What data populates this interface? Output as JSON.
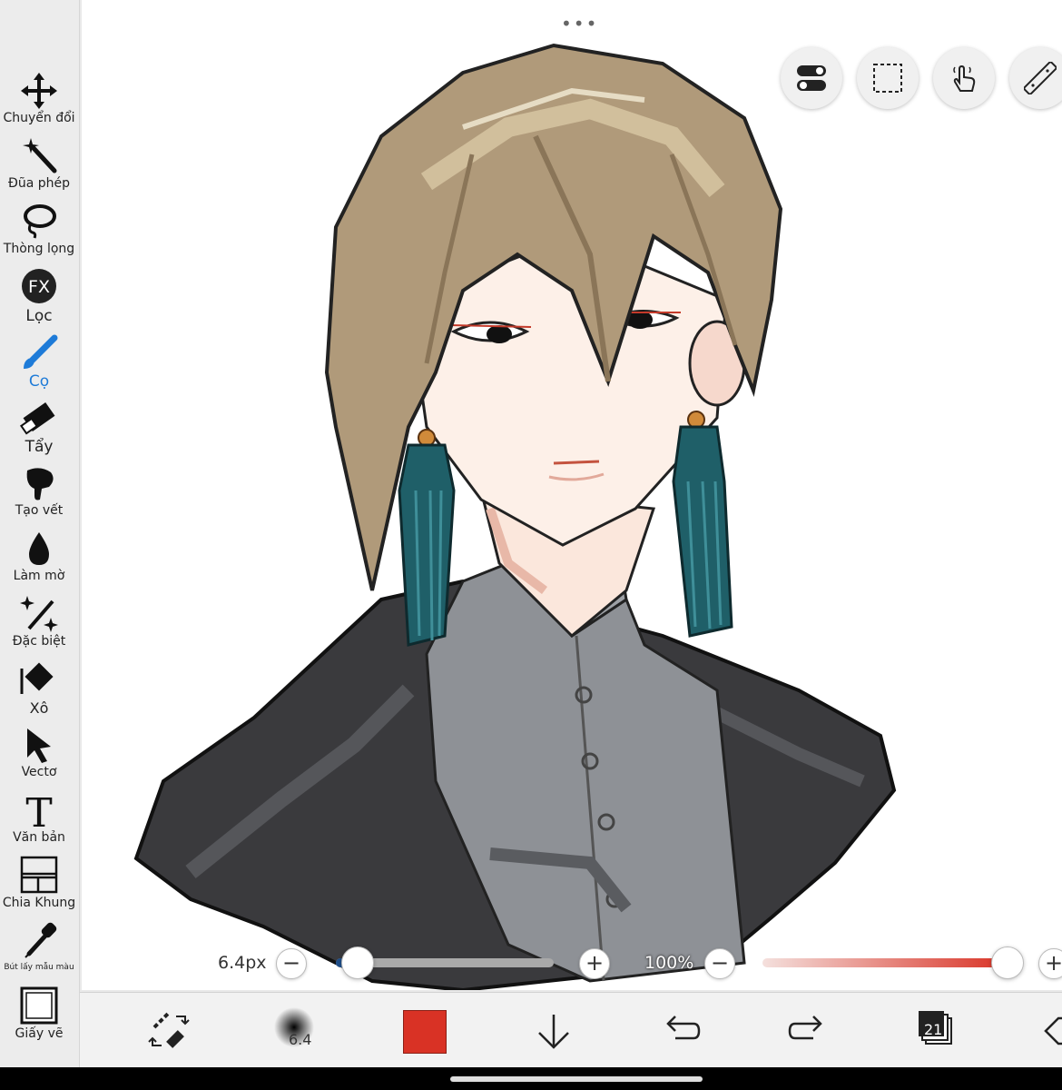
{
  "sidebar": {
    "tools": [
      {
        "label": "Chuyển đổi",
        "icon": "move-arrows-icon",
        "active": false
      },
      {
        "label": "Đũa phép",
        "icon": "magic-wand-icon",
        "active": false
      },
      {
        "label": "Thòng lọng",
        "icon": "lasso-icon",
        "active": false
      },
      {
        "label": "Lọc",
        "icon": "fx-filter-icon",
        "active": false,
        "icon_text": "FX"
      },
      {
        "label": "Cọ",
        "icon": "brush-icon",
        "active": true
      },
      {
        "label": "Tẩy",
        "icon": "eraser-icon",
        "active": false
      },
      {
        "label": "Tạo vết",
        "icon": "smudge-icon",
        "active": false
      },
      {
        "label": "Làm mờ",
        "icon": "blur-drop-icon",
        "active": false
      },
      {
        "label": "Đặc biệt",
        "icon": "special-sparkle-icon",
        "active": false
      },
      {
        "label": "Xô",
        "icon": "bucket-icon",
        "active": false
      },
      {
        "label": "Vectơ",
        "icon": "vector-cursor-icon",
        "active": false
      },
      {
        "label": "Văn bản",
        "icon": "text-icon",
        "active": false,
        "icon_text": "T"
      },
      {
        "label": "Chia Khung",
        "icon": "frame-divider-icon",
        "active": false
      },
      {
        "label": "Bút lấy mẫu màu",
        "icon": "eyedropper-icon",
        "active": false
      },
      {
        "label": "Giấy vẽ",
        "icon": "canvas-paper-icon",
        "active": false
      }
    ]
  },
  "top_controls": {
    "more_dots": "•••",
    "buttons": [
      "toggle-settings-icon",
      "selection-icon",
      "touch-gesture-icon",
      "ruler-icon"
    ]
  },
  "slider_row": {
    "brush_size": "6.4px",
    "brush_size_fraction": 0.03,
    "minus": "−",
    "plus": "+",
    "opacity": "100%",
    "opacity_fraction": 1.0
  },
  "bottom_bar": {
    "brush_preview_size": "6.4",
    "color": "#d93225",
    "layers_count": "21",
    "icons": [
      "swap-brush-eraser-icon",
      "brush-preview-icon",
      "color-swatch",
      "download-arrow-icon",
      "undo-icon",
      "redo-icon",
      "layers-icon",
      "back-icon"
    ]
  },
  "colors": {
    "accent": "#1e7bd8",
    "opacity_track": "#d93225",
    "size_track": "#1f4f8a"
  }
}
